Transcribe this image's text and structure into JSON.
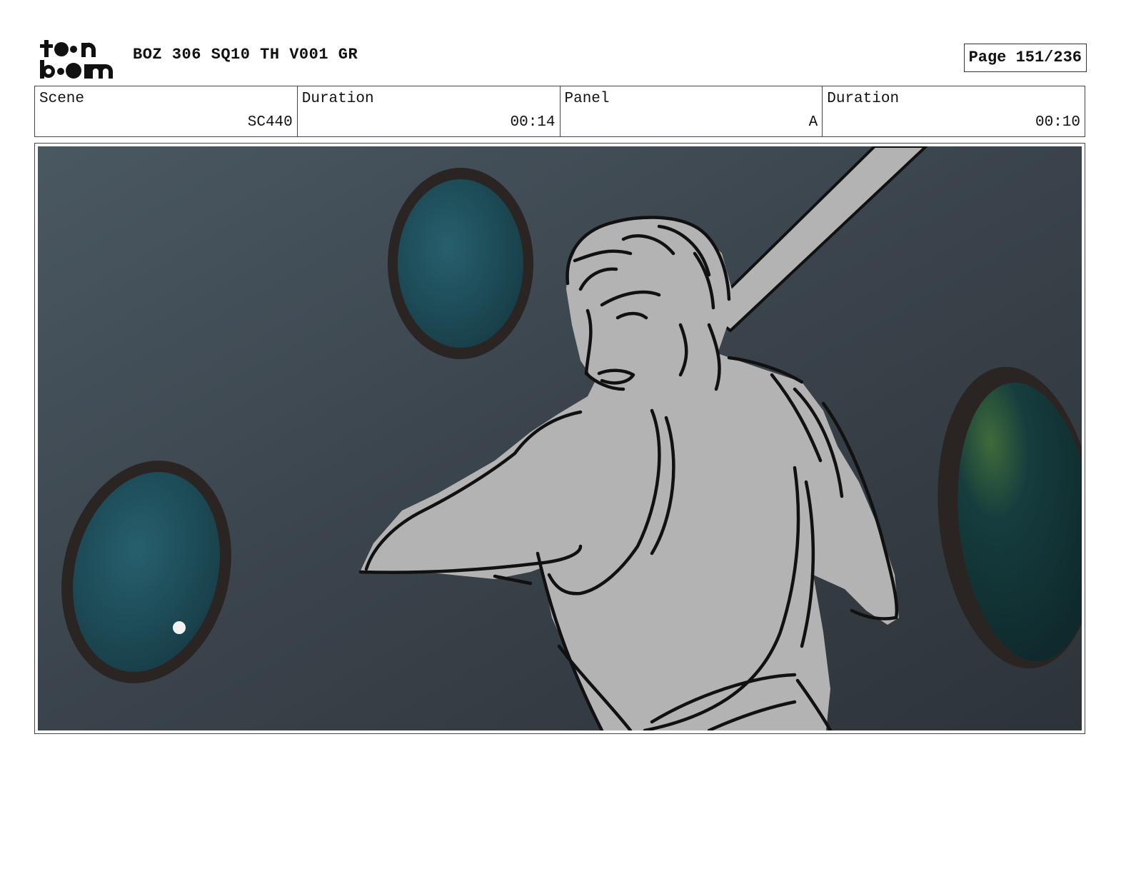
{
  "header": {
    "logo_text": "toon boom",
    "project_title": "BOZ 306 SQ10 TH V001 GR",
    "page_label": "Page 151/236"
  },
  "info": {
    "scene_label": "Scene",
    "scene_value": "SC440",
    "scene_duration_label": "Duration",
    "scene_duration_value": "00:14",
    "panel_label": "Panel",
    "panel_value": "A",
    "panel_duration_label": "Duration",
    "panel_duration_value": "00:10"
  },
  "panel": {
    "background_color": "#3a434b",
    "porthole_glass_color": "#1d4a56",
    "figure_fill_color": "#b3b3b3"
  }
}
